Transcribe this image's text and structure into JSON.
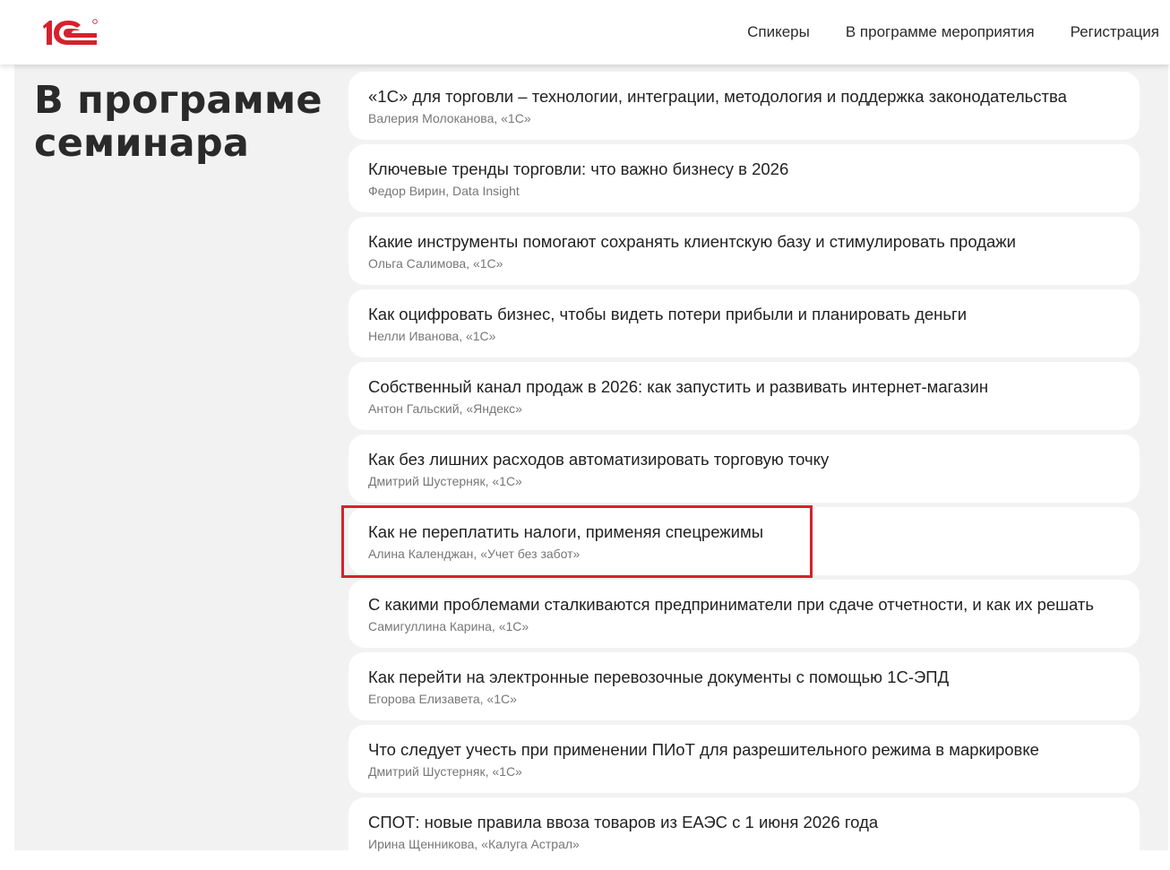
{
  "header": {
    "logo_text": "1С",
    "nav": [
      {
        "label": "Спикеры"
      },
      {
        "label": "В программе мероприятия"
      },
      {
        "label": "Регистрация"
      }
    ]
  },
  "colors": {
    "brand_red": "#d6212e",
    "highlight": "#d6212e"
  },
  "main": {
    "title": "В программе семинара",
    "items": [
      {
        "title": "«1С» для торговли – технологии, интеграции, методология и поддержка законодательства",
        "speaker": "Валерия Молоканова, «1С»"
      },
      {
        "title": "Ключевые тренды торговли: что важно бизнесу в 2026",
        "speaker": "Федор Вирин, Data Insight"
      },
      {
        "title": "Какие инструменты помогают сохранять клиентскую базу и стимулировать продажи",
        "speaker": "Ольга Салимова, «1С»"
      },
      {
        "title": "Как оцифровать бизнес, чтобы видеть потери прибыли и планировать деньги",
        "speaker": "Нелли Иванова, «1С»"
      },
      {
        "title": "Собственный канал продаж в 2026: как запустить и развивать интернет-магазин",
        "speaker": "Антон Гальский, «Яндекс»"
      },
      {
        "title": "Как без лишних расходов автоматизировать торговую точку",
        "speaker": "Дмитрий Шустерняк, «1С»"
      },
      {
        "title": "Как не переплатить налоги, применяя спецрежимы",
        "speaker": "Алина Календжан, «Учет без забот»"
      },
      {
        "title": "С какими проблемами сталкиваются предприниматели при сдаче отчетности, и как их решать",
        "speaker": "Самигуллина Карина, «1С»"
      },
      {
        "title": "Как перейти на электронные перевозочные документы с помощью 1С-ЭПД",
        "speaker": "Егорова Елизавета, «1С»"
      },
      {
        "title": "Что следует учесть при применении ПИоТ для разрешительного режима в маркировке",
        "speaker": "Дмитрий Шустерняк, «1С»"
      },
      {
        "title": "СПОТ: новые правила ввоза товаров из ЕАЭС с 1 июня 2026 года",
        "speaker": "Ирина Щенникова, «Калуга Астрал»"
      }
    ]
  }
}
